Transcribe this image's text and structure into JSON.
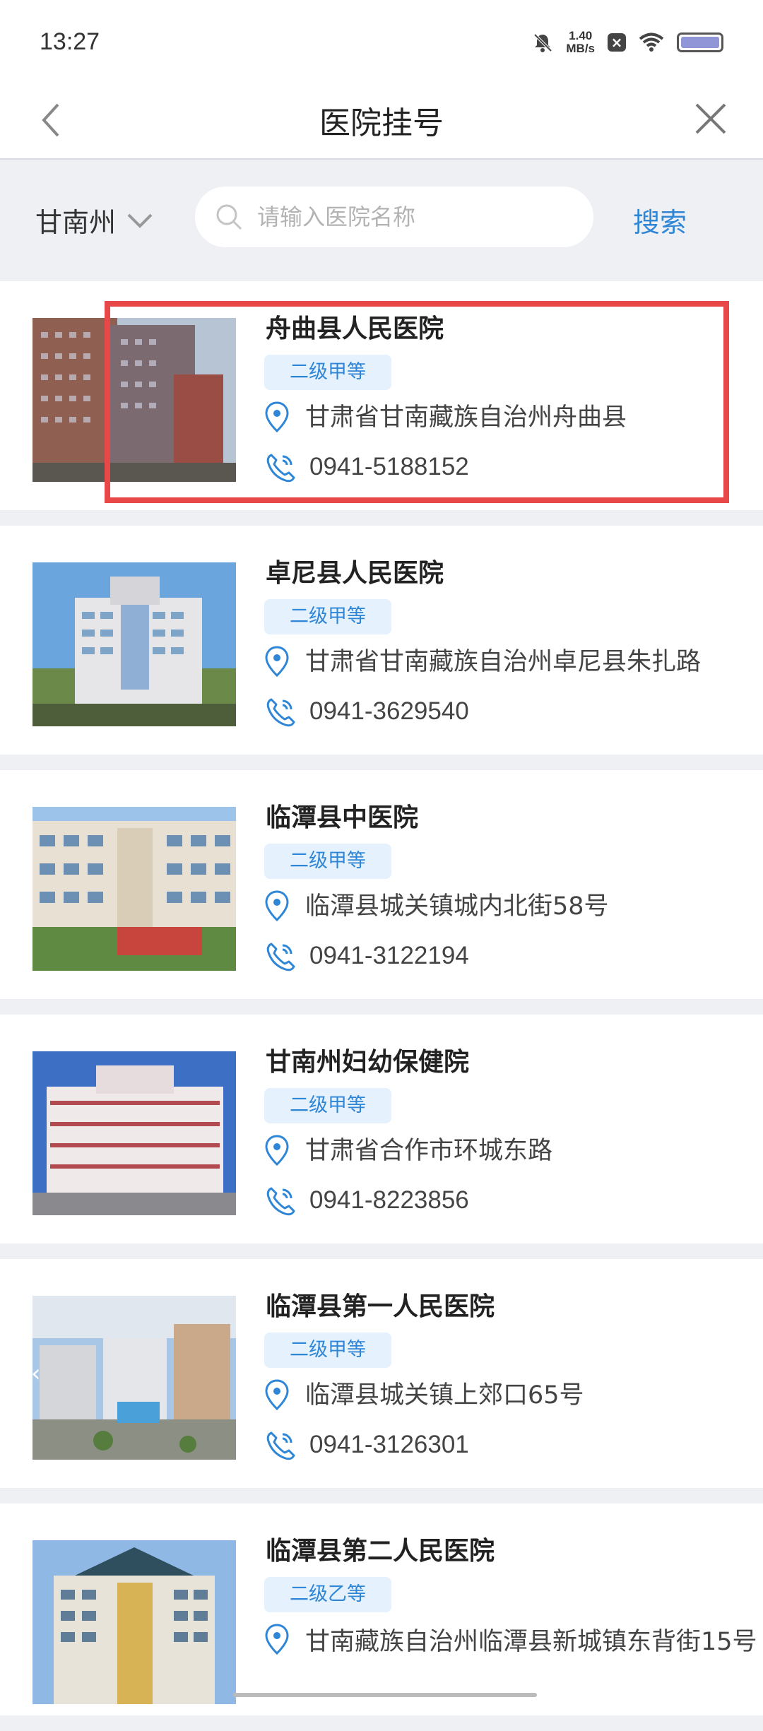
{
  "status_bar": {
    "time": "13:27",
    "net_speed_value": "1.40",
    "net_speed_unit": "MB/s"
  },
  "header": {
    "title": "医院挂号"
  },
  "search": {
    "city": "甘南州",
    "placeholder": "请输入医院名称",
    "button_label": "搜索"
  },
  "colors": {
    "accent": "#2f86d6",
    "badge_bg": "#e5f1fc",
    "highlight": "#e84848"
  },
  "hospitals": [
    {
      "name": "舟曲县人民医院",
      "level": "二级甲等",
      "address": "甘肃省甘南藏族自治州舟曲县",
      "phone": "0941-5188152"
    },
    {
      "name": "卓尼县人民医院",
      "level": "二级甲等",
      "address": "甘肃省甘南藏族自治州卓尼县朱扎路",
      "phone": "0941-3629540"
    },
    {
      "name": "临潭县中医院",
      "level": "二级甲等",
      "address": "临潭县城关镇城内北街58号",
      "phone": "0941-3122194"
    },
    {
      "name": "甘南州妇幼保健院",
      "level": "二级甲等",
      "address": "甘肃省合作市环城东路",
      "phone": "0941-8223856"
    },
    {
      "name": "临潭县第一人民医院",
      "level": "二级甲等",
      "address": "临潭县城关镇上郊口65号",
      "phone": "0941-3126301"
    },
    {
      "name": "临潭县第二人民医院",
      "level": "二级乙等",
      "address": "甘南藏族自治州临潭县新城镇东背街15号",
      "phone": ""
    }
  ]
}
